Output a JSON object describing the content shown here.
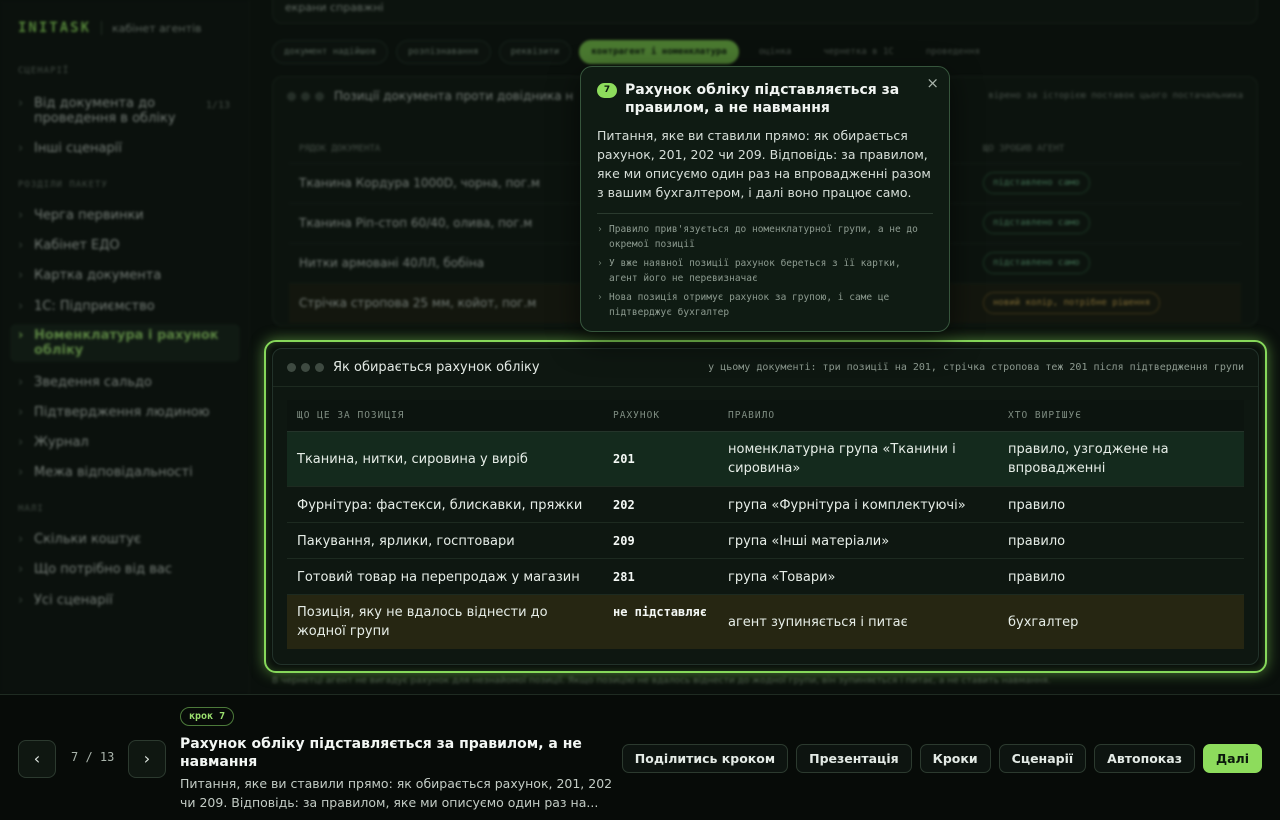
{
  "sidebar": {
    "brand": "INITASK",
    "brand_sub": "кабінет агентів",
    "sections": {
      "scenarios": "СЦЕНАРІЇ",
      "package": "РОЗДІЛИ ПАКЕТУ",
      "next": "НАЛІ"
    },
    "scenario_items": [
      {
        "label": "Від документа до проведення в обліку",
        "count": "1/13"
      },
      {
        "label": "Інші сценарії"
      }
    ],
    "package_items": [
      {
        "label": "Черга первинки"
      },
      {
        "label": "Кабінет ЕДО"
      },
      {
        "label": "Картка документа"
      },
      {
        "label": "1С: Підприємство"
      },
      {
        "label": "Номенклатура і рахунок обліку"
      },
      {
        "label": "Зведення сальдо"
      },
      {
        "label": "Підтвердження людиною"
      },
      {
        "label": "Журнал"
      },
      {
        "label": "Межа відповідальності"
      }
    ],
    "next_items": [
      {
        "label": "Скільки коштує"
      },
      {
        "label": "Що потрібно від вас"
      },
      {
        "label": "Усі сценарії"
      }
    ]
  },
  "background": {
    "top_text": "екрани справжні",
    "chips": [
      "документ надійшов",
      "розпізнавання",
      "реквізити",
      "контрагент і номенклатура",
      "оцінка",
      "чернетка в 1С",
      "проведення"
    ],
    "panel_title": "Позиції документа проти довідника н",
    "panel_note": "вірено за історією поставок цього постачальника",
    "col_left": "РЯДОК ДОКУМЕНТА",
    "col_right": "ЩО ЗРОБИВ АГЕНТ",
    "rows": [
      {
        "item": "Тканина Кордура 1000D, чорна, пог.м",
        "status": "підставлено само"
      },
      {
        "item": "Тканина Рiп-стоп 60/40, олива, пог.м",
        "status": "підставлено само"
      },
      {
        "item": "Нитки армовані 40ЛЛ, бобіна",
        "status": "підставлено само"
      },
      {
        "item": "Стрічка стропова 25 мм, койот, пог.м",
        "status": "новий колір, потрібне рішення"
      }
    ],
    "caption": "В чернетці агент не вигадує рахунок для незнайомої позиції. Якщо позицію не вдалось віднести до жодної групи, він зупиняється і питає, а не ставить навмання."
  },
  "popover": {
    "step_num": "7",
    "title": "Рахунок обліку підставляється за правилом, а не навмання",
    "body": "Питання, яке ви ставили прямо: як обирається рахунок, 201, 202 чи 209. Відповідь: за правилом, яке ми описуємо один раз на впровадженні разом з вашим бухгалтером, і далі воно працює само.",
    "bullets": [
      "Правило прив'язується до номенклатурної групи, а не до окремої позиції",
      "У вже наявної позиції рахунок береться з її картки, агент його не перевизначає",
      "Нова позиція отримує рахунок за групою, і саме це підтверджує бухгалтер"
    ],
    "close": "×"
  },
  "focus_panel": {
    "title": "Як обирається рахунок обліку",
    "note": "у цьому документі: три позиції на 201, стрічка стропова теж 201 після підтвердження групи",
    "headers": [
      "ЩО ЦЕ ЗА ПОЗИЦІЯ",
      "РАХУНОК",
      "ПРАВИЛО",
      "ХТО ВИРІШУЄ"
    ],
    "rows": [
      [
        "Тканина, нитки, сировина у виріб",
        "201",
        "номенклатурна група «Тканини і сировина»",
        "правило, узгоджене на впровадженні"
      ],
      [
        "Фурнітура: фастекси, блискавки, пряжки",
        "202",
        "група «Фурнітура і комплектуючі»",
        "правило"
      ],
      [
        "Пакування, ярлики, госптовари",
        "209",
        "група «Інші матеріали»",
        "правило"
      ],
      [
        "Готовий товар на перепродаж у магазин",
        "281",
        "група «Товари»",
        "правило"
      ],
      [
        "Позиція, яку не вдалось віднести до жодної групи",
        "не підставляє",
        "агент зупиняється і питає",
        "бухгалтер"
      ]
    ]
  },
  "bottombar": {
    "prev": "‹",
    "next": "›",
    "counter": "7 / 13",
    "step_chip": "крок 7",
    "title": "Рахунок обліку підставляється за правилом, а не навмання",
    "desc": "Питання, яке ви ставили прямо: як обирається рахунок, 201, 202 чи 209. Відповідь: за правилом, яке ми описуємо один раз на...",
    "actions": {
      "share": "Поділитись кроком",
      "presentation": "Презентація",
      "steps": "Кроки",
      "scenarios": "Сценарії",
      "autoplay": "Автопоказ",
      "next": "Далі"
    }
  },
  "colors": {
    "accent": "#8ddc5c",
    "background": "#0a100c",
    "warn": "#e0b454"
  }
}
